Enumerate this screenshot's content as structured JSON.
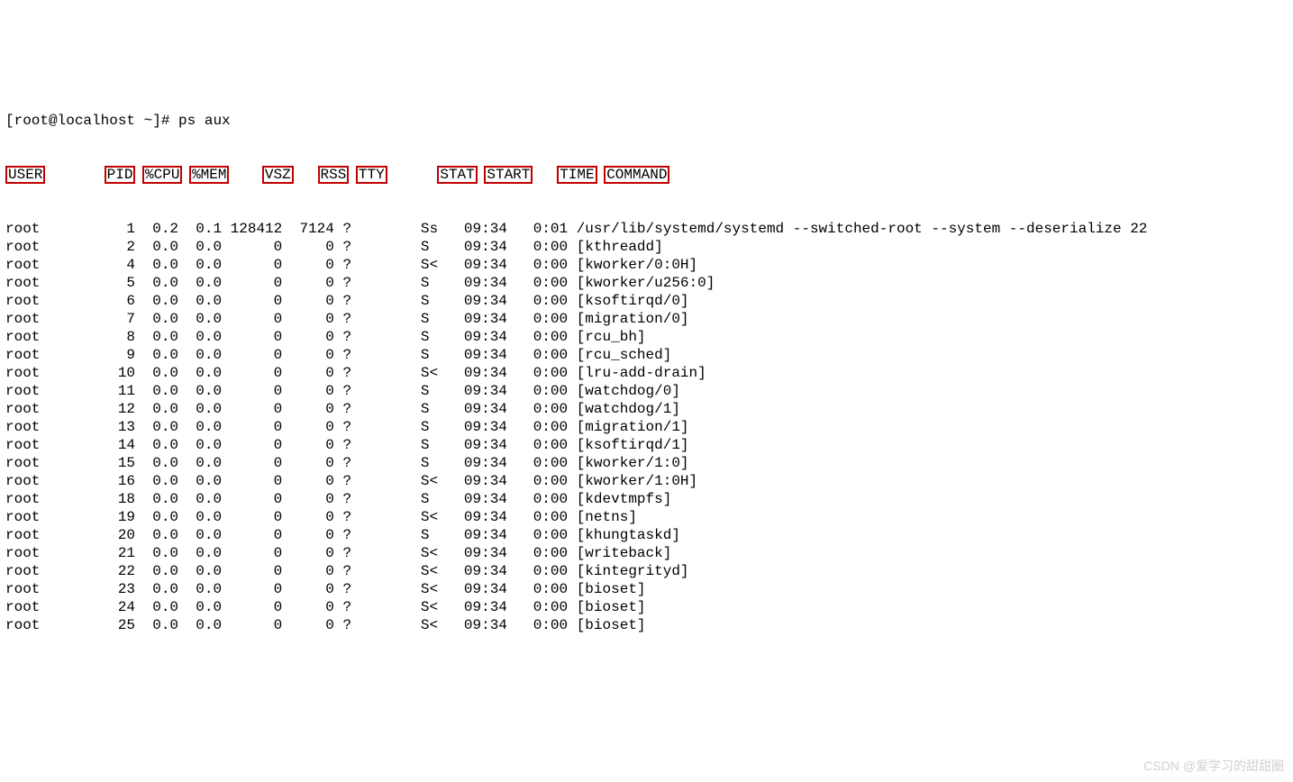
{
  "prompt": "[root@localhost ~]# ps aux",
  "headers": {
    "USER": "USER",
    "PID": "PID",
    "CPU": "%CPU",
    "MEM": "%MEM",
    "VSZ": "VSZ",
    "RSS": "RSS",
    "TTY": "TTY",
    "STAT": "STAT",
    "START": "START",
    "TIME": "TIME",
    "COMMAND": "COMMAND"
  },
  "rows": [
    {
      "user": "root",
      "pid": "1",
      "cpu": "0.2",
      "mem": "0.1",
      "vsz": "128412",
      "rss": "7124",
      "tty": "?",
      "stat": "Ss",
      "start": "09:34",
      "time": "0:01",
      "cmd": "/usr/lib/systemd/systemd --switched-root --system --deserialize 22"
    },
    {
      "user": "root",
      "pid": "2",
      "cpu": "0.0",
      "mem": "0.0",
      "vsz": "0",
      "rss": "0",
      "tty": "?",
      "stat": "S",
      "start": "09:34",
      "time": "0:00",
      "cmd": "[kthreadd]"
    },
    {
      "user": "root",
      "pid": "4",
      "cpu": "0.0",
      "mem": "0.0",
      "vsz": "0",
      "rss": "0",
      "tty": "?",
      "stat": "S<",
      "start": "09:34",
      "time": "0:00",
      "cmd": "[kworker/0:0H]"
    },
    {
      "user": "root",
      "pid": "5",
      "cpu": "0.0",
      "mem": "0.0",
      "vsz": "0",
      "rss": "0",
      "tty": "?",
      "stat": "S",
      "start": "09:34",
      "time": "0:00",
      "cmd": "[kworker/u256:0]"
    },
    {
      "user": "root",
      "pid": "6",
      "cpu": "0.0",
      "mem": "0.0",
      "vsz": "0",
      "rss": "0",
      "tty": "?",
      "stat": "S",
      "start": "09:34",
      "time": "0:00",
      "cmd": "[ksoftirqd/0]"
    },
    {
      "user": "root",
      "pid": "7",
      "cpu": "0.0",
      "mem": "0.0",
      "vsz": "0",
      "rss": "0",
      "tty": "?",
      "stat": "S",
      "start": "09:34",
      "time": "0:00",
      "cmd": "[migration/0]"
    },
    {
      "user": "root",
      "pid": "8",
      "cpu": "0.0",
      "mem": "0.0",
      "vsz": "0",
      "rss": "0",
      "tty": "?",
      "stat": "S",
      "start": "09:34",
      "time": "0:00",
      "cmd": "[rcu_bh]"
    },
    {
      "user": "root",
      "pid": "9",
      "cpu": "0.0",
      "mem": "0.0",
      "vsz": "0",
      "rss": "0",
      "tty": "?",
      "stat": "S",
      "start": "09:34",
      "time": "0:00",
      "cmd": "[rcu_sched]"
    },
    {
      "user": "root",
      "pid": "10",
      "cpu": "0.0",
      "mem": "0.0",
      "vsz": "0",
      "rss": "0",
      "tty": "?",
      "stat": "S<",
      "start": "09:34",
      "time": "0:00",
      "cmd": "[lru-add-drain]"
    },
    {
      "user": "root",
      "pid": "11",
      "cpu": "0.0",
      "mem": "0.0",
      "vsz": "0",
      "rss": "0",
      "tty": "?",
      "stat": "S",
      "start": "09:34",
      "time": "0:00",
      "cmd": "[watchdog/0]"
    },
    {
      "user": "root",
      "pid": "12",
      "cpu": "0.0",
      "mem": "0.0",
      "vsz": "0",
      "rss": "0",
      "tty": "?",
      "stat": "S",
      "start": "09:34",
      "time": "0:00",
      "cmd": "[watchdog/1]"
    },
    {
      "user": "root",
      "pid": "13",
      "cpu": "0.0",
      "mem": "0.0",
      "vsz": "0",
      "rss": "0",
      "tty": "?",
      "stat": "S",
      "start": "09:34",
      "time": "0:00",
      "cmd": "[migration/1]"
    },
    {
      "user": "root",
      "pid": "14",
      "cpu": "0.0",
      "mem": "0.0",
      "vsz": "0",
      "rss": "0",
      "tty": "?",
      "stat": "S",
      "start": "09:34",
      "time": "0:00",
      "cmd": "[ksoftirqd/1]"
    },
    {
      "user": "root",
      "pid": "15",
      "cpu": "0.0",
      "mem": "0.0",
      "vsz": "0",
      "rss": "0",
      "tty": "?",
      "stat": "S",
      "start": "09:34",
      "time": "0:00",
      "cmd": "[kworker/1:0]"
    },
    {
      "user": "root",
      "pid": "16",
      "cpu": "0.0",
      "mem": "0.0",
      "vsz": "0",
      "rss": "0",
      "tty": "?",
      "stat": "S<",
      "start": "09:34",
      "time": "0:00",
      "cmd": "[kworker/1:0H]"
    },
    {
      "user": "root",
      "pid": "18",
      "cpu": "0.0",
      "mem": "0.0",
      "vsz": "0",
      "rss": "0",
      "tty": "?",
      "stat": "S",
      "start": "09:34",
      "time": "0:00",
      "cmd": "[kdevtmpfs]"
    },
    {
      "user": "root",
      "pid": "19",
      "cpu": "0.0",
      "mem": "0.0",
      "vsz": "0",
      "rss": "0",
      "tty": "?",
      "stat": "S<",
      "start": "09:34",
      "time": "0:00",
      "cmd": "[netns]"
    },
    {
      "user": "root",
      "pid": "20",
      "cpu": "0.0",
      "mem": "0.0",
      "vsz": "0",
      "rss": "0",
      "tty": "?",
      "stat": "S",
      "start": "09:34",
      "time": "0:00",
      "cmd": "[khungtaskd]"
    },
    {
      "user": "root",
      "pid": "21",
      "cpu": "0.0",
      "mem": "0.0",
      "vsz": "0",
      "rss": "0",
      "tty": "?",
      "stat": "S<",
      "start": "09:34",
      "time": "0:00",
      "cmd": "[writeback]"
    },
    {
      "user": "root",
      "pid": "22",
      "cpu": "0.0",
      "mem": "0.0",
      "vsz": "0",
      "rss": "0",
      "tty": "?",
      "stat": "S<",
      "start": "09:34",
      "time": "0:00",
      "cmd": "[kintegrityd]"
    },
    {
      "user": "root",
      "pid": "23",
      "cpu": "0.0",
      "mem": "0.0",
      "vsz": "0",
      "rss": "0",
      "tty": "?",
      "stat": "S<",
      "start": "09:34",
      "time": "0:00",
      "cmd": "[bioset]"
    },
    {
      "user": "root",
      "pid": "24",
      "cpu": "0.0",
      "mem": "0.0",
      "vsz": "0",
      "rss": "0",
      "tty": "?",
      "stat": "S<",
      "start": "09:34",
      "time": "0:00",
      "cmd": "[bioset]"
    },
    {
      "user": "root",
      "pid": "25",
      "cpu": "0.0",
      "mem": "0.0",
      "vsz": "0",
      "rss": "0",
      "tty": "?",
      "stat": "S<",
      "start": "09:34",
      "time": "0:00",
      "cmd": "[bioset]"
    }
  ],
  "watermark": "CSDN @爱学习的甜甜圈"
}
